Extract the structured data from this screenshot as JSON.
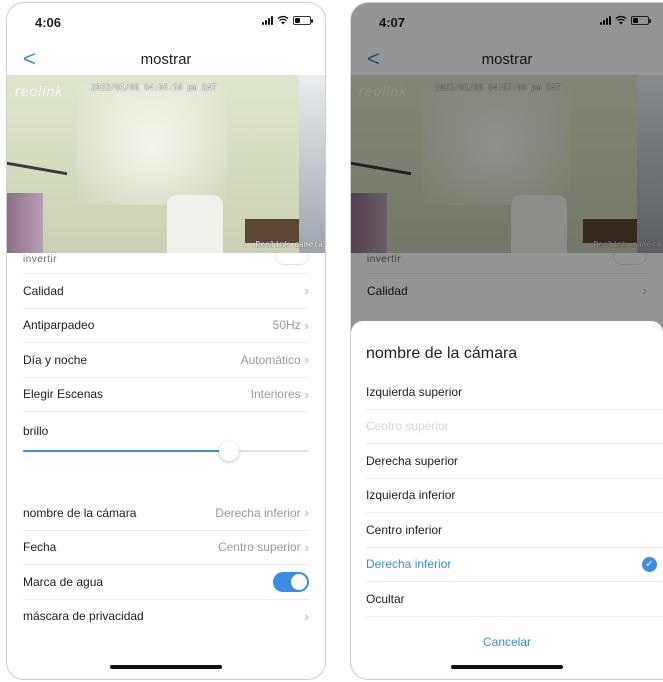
{
  "left": {
    "status": {
      "time": "4:06"
    },
    "nav": {
      "back": "<",
      "title": "mostrar"
    },
    "feed": {
      "logo": "reolink",
      "timestamp": "2022/01/08 04:06:50 pm SAT",
      "camera_label": "Reolink camera"
    },
    "partial_row": {
      "label": "invertir"
    },
    "rows": [
      {
        "label": "Calidad",
        "value": ""
      },
      {
        "label": "Antiparpadeo",
        "value": "50Hz"
      },
      {
        "label": "Día y noche",
        "value": "Automático"
      },
      {
        "label": "Elegir Escenas",
        "value": "Interiores"
      }
    ],
    "brightness": {
      "label": "brillo",
      "level_percent": 72
    },
    "rows2": [
      {
        "label": "nombre de la cámara",
        "value": "Derecha inferior"
      },
      {
        "label": "Fecha",
        "value": "Centro superior"
      }
    ],
    "watermark": {
      "label": "Marca de agua",
      "on": true
    },
    "privacy": {
      "label": "máscara de privacidad"
    }
  },
  "right": {
    "status": {
      "time": "4:07"
    },
    "nav": {
      "back": "<",
      "title": "mostrar"
    },
    "feed": {
      "logo": "reolink",
      "timestamp": "2022/01/08 04:07:00 pm SAT",
      "camera_label": "Reolink camera"
    },
    "partial_row": {
      "label": "invertir"
    },
    "rows": [
      {
        "label": "Calidad",
        "value": ""
      }
    ],
    "sheet": {
      "title": "nombre de la cámara",
      "options": [
        {
          "label": "Izquierda superior",
          "state": "normal"
        },
        {
          "label": "Centro superior",
          "state": "disabled"
        },
        {
          "label": "Derecha superior",
          "state": "normal"
        },
        {
          "label": "Izquierda inferior",
          "state": "normal"
        },
        {
          "label": "Centro inferior",
          "state": "normal"
        },
        {
          "label": "Derecha inferior",
          "state": "selected"
        },
        {
          "label": "Ocultar",
          "state": "normal"
        }
      ],
      "cancel": "Cancelar"
    }
  },
  "colors": {
    "accent": "#3b8de4",
    "muted": "#9a9a9a"
  },
  "icons": {
    "back": "chevron-left-icon",
    "row_arrow": "chevron-right-icon",
    "check": "check-circle-icon"
  }
}
